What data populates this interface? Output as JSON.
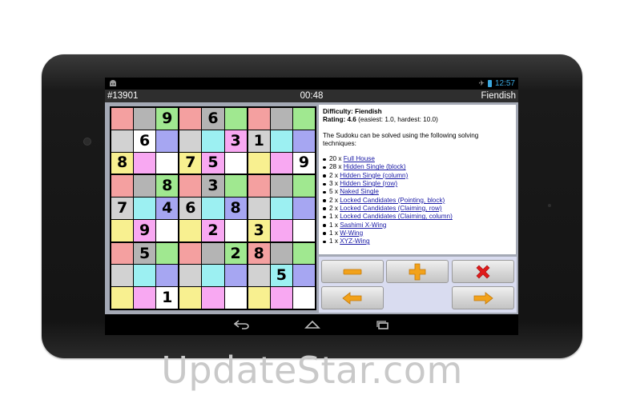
{
  "statusbar": {
    "time": "12:57",
    "left_icon": "android-icon",
    "airplane_icon": "airplane-icon",
    "battery_icon": "battery-icon"
  },
  "titlebar": {
    "puzzle_id": "#13901",
    "timer": "00:48",
    "difficulty": "Fiendish"
  },
  "board": {
    "rows": [
      [
        "",
        "",
        "9",
        "",
        "6",
        "",
        "",
        "",
        ""
      ],
      [
        "",
        "6",
        "",
        "",
        "",
        "3",
        "1",
        "",
        ""
      ],
      [
        "8",
        "",
        "",
        "7",
        "5",
        "",
        "",
        "",
        "9"
      ],
      [
        "",
        "",
        "8",
        "",
        "3",
        "",
        "",
        "",
        ""
      ],
      [
        "7",
        "",
        "4",
        "6",
        "",
        "8",
        "",
        "",
        ""
      ],
      [
        "",
        "9",
        "",
        "",
        "2",
        "",
        "3",
        "",
        ""
      ],
      [
        "",
        "5",
        "",
        "",
        "",
        "2",
        "8",
        "",
        ""
      ],
      [
        "",
        "",
        "",
        "",
        "",
        "",
        "",
        "5",
        ""
      ],
      [
        "",
        "",
        "1",
        "",
        "",
        "",
        "",
        "",
        ""
      ]
    ],
    "colors": [
      [
        "#f4a0a0",
        "#b4b4b4",
        "#a0e890",
        "#f4a0a0",
        "#b4b4b4",
        "#a0e890",
        "#f4a0a0",
        "#b4b4b4",
        "#a0e890"
      ],
      [
        "#d2d2d2",
        "#ffffff",
        "#a6a6f2",
        "#d2d2d2",
        "#9cf0f2",
        "#f8a8f2",
        "#d2d2d2",
        "#9cf0f2",
        "#a6a6f2"
      ],
      [
        "#f8f090",
        "#f8a8f2",
        "#ffffff",
        "#f8f090",
        "#f8a8f2",
        "#ffffff",
        "#f8f090",
        "#f8a8f2",
        "#ffffff"
      ],
      [
        "#f4a0a0",
        "#b4b4b4",
        "#a0e890",
        "#f4a0a0",
        "#b4b4b4",
        "#a0e890",
        "#f4a0a0",
        "#b4b4b4",
        "#a0e890"
      ],
      [
        "#d2d2d2",
        "#9cf0f2",
        "#a6a6f2",
        "#d2d2d2",
        "#9cf0f2",
        "#a6a6f2",
        "#d2d2d2",
        "#9cf0f2",
        "#a6a6f2"
      ],
      [
        "#f8f090",
        "#f8a8f2",
        "#ffffff",
        "#f8f090",
        "#f8a8f2",
        "#ffffff",
        "#f8f090",
        "#f8a8f2",
        "#ffffff"
      ],
      [
        "#f4a0a0",
        "#b4b4b4",
        "#a0e890",
        "#f4a0a0",
        "#b4b4b4",
        "#a0e890",
        "#f4a0a0",
        "#b4b4b4",
        "#a0e890"
      ],
      [
        "#d2d2d2",
        "#9cf0f2",
        "#a6a6f2",
        "#d2d2d2",
        "#9cf0f2",
        "#a6a6f2",
        "#d2d2d2",
        "#9cf0f2",
        "#a6a6f2"
      ],
      [
        "#f8f090",
        "#f8a8f2",
        "#ffffff",
        "#f8f090",
        "#f8a8f2",
        "#ffffff",
        "#f8f090",
        "#f8a8f2",
        "#ffffff"
      ]
    ]
  },
  "info": {
    "difficulty_label": "Difficulty: Fiendish",
    "rating_label": "Rating: 4.6",
    "rating_note": " (easiest: 1.0, hardest: 10.0)",
    "intro": "The Sudoku can be solved using the following solving techniques:",
    "techniques": [
      {
        "count": "20 x ",
        "name": "Full House"
      },
      {
        "count": "28 x ",
        "name": "Hidden Single (block)"
      },
      {
        "count": "2 x ",
        "name": "Hidden Single (column)"
      },
      {
        "count": "3 x ",
        "name": "Hidden Single (row)"
      },
      {
        "count": "5 x ",
        "name": "Naked Single"
      },
      {
        "count": "2 x ",
        "name": "Locked Candidates (Pointing, block)"
      },
      {
        "count": "2 x ",
        "name": "Locked Candidates (Claiming, row)"
      },
      {
        "count": "1 x ",
        "name": "Locked Candidates (Claiming, column)"
      },
      {
        "count": "1 x ",
        "name": "Sashimi X-Wing"
      },
      {
        "count": "1 x ",
        "name": "W-Wing"
      },
      {
        "count": "1 x ",
        "name": "XYZ-Wing"
      }
    ]
  },
  "buttons": {
    "minus": "minus-icon",
    "plus": "plus-icon",
    "close": "close-icon",
    "previous": "arrow-left-icon",
    "next": "arrow-right-icon",
    "accent_orange": "#f2a21a",
    "close_red": "#e01a1a"
  },
  "navbar": {
    "back": "back-icon",
    "home": "home-icon",
    "recents": "recents-icon"
  },
  "watermark": "UpdateStar.com"
}
